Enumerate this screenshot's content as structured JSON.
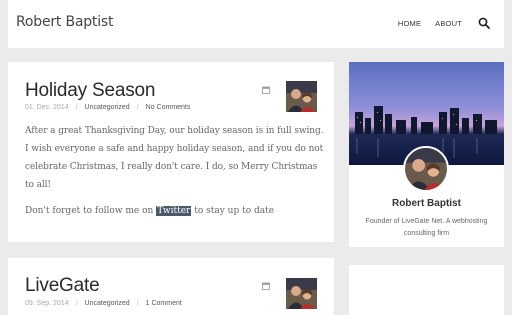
{
  "site": {
    "title": "Robert Baptist"
  },
  "nav": {
    "items": [
      "HOME",
      "ABOUT"
    ],
    "search_icon": "search-icon"
  },
  "posts": [
    {
      "title": "Holiday Season",
      "date": "01. Dec. 2014",
      "category": "Uncategorized",
      "comments": "No Comments",
      "body": "After a great Thanksgiving Day, our holiday season is in full swing. I wish everyone a safe and happy holiday season, and if you do not celebrate Christmas, I really don't care. I do, so Merry Christmas to all!",
      "follow_prefix": "Don't forget to follow me on",
      "follow_link": "Twitter",
      "follow_suffix": "to stay up to date"
    },
    {
      "title": "LiveGate",
      "date": "09. Sep. 2014",
      "category": "Uncategorized",
      "comments": "1 Comment"
    }
  ],
  "profile": {
    "name": "Robert Baptist",
    "bio": "Founder of LiveGate Net. A webhosting consulting firm"
  },
  "colors": {
    "twitter_highlight": "#4a5868",
    "background": "#ebebeb"
  }
}
